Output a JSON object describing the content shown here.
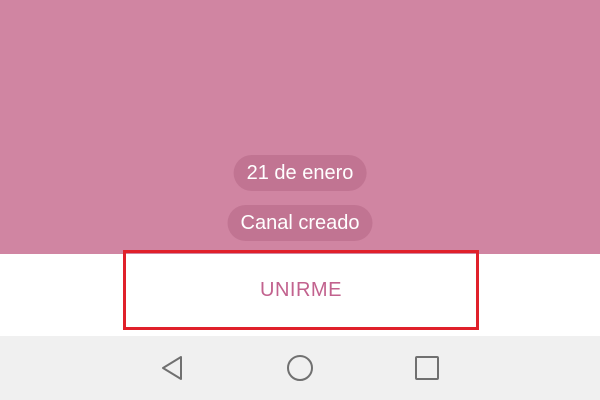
{
  "chat": {
    "background_color": "#d085a2",
    "service_messages": {
      "date": "21 de enero",
      "event": "Canal creado"
    }
  },
  "join_bar": {
    "join_label": "UNIRME",
    "label_color": "#c2628e",
    "highlight_color": "#e0202a"
  },
  "system_nav": {
    "back_icon": "back-triangle-icon",
    "home_icon": "home-circle-icon",
    "recents_icon": "recents-square-icon"
  }
}
